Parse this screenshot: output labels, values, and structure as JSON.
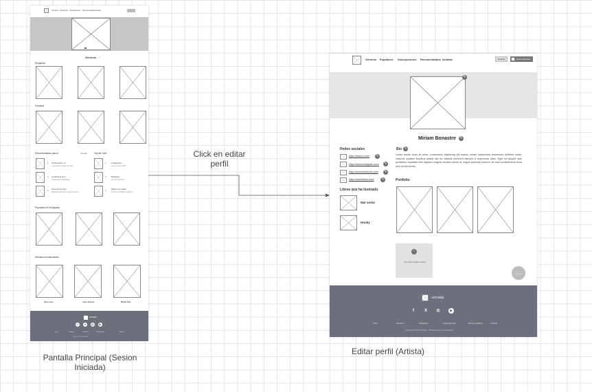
{
  "captions": {
    "left": "Pantalla Principal (Sesion Iniciada)",
    "right": "Editar perfil (Artista)",
    "arrow": "Click en editar perfil"
  },
  "left": {
    "nav": [
      "Generos",
      "Populares",
      "Suscripciones",
      "Recomendados",
      "Artistas"
    ],
    "genres_title": "Generos",
    "sec1": "Escapista",
    "sec2": "Fantasía",
    "list_title": "Recomendados para ti",
    "list_more": "Ver todo",
    "list_title2": "Top del mes",
    "list_items": [
      {
        "n": "1",
        "title": "Profesionales y el",
        "sub": "Lorem ipsum dolor sit amet"
      },
      {
        "n": "2",
        "title": "La Mitología de el",
        "sub": "Consectetur adipiscing"
      },
      {
        "n": "3",
        "title": "Aventuras de Sara",
        "sub": "Phantasmagoria de Nuestra Tierra"
      }
    ],
    "list_items2": [
      {
        "n": "1",
        "title": "Protagonista",
        "sub": "Lorem ipsum dolor"
      },
      {
        "n": "2",
        "title": "Mitologías",
        "sub": "Sed do eiusmod"
      },
      {
        "n": "3",
        "title": "Relatos de espada",
        "sub": "Tempor incididunt ut labore"
      }
    ],
    "sec3": "Populares en Escapista",
    "sec4": "Artistas recomendados",
    "artists": [
      "Sam Lopez",
      "Carla Jiménez",
      "Miriam Ruiz"
    ],
    "footer_brand": "ArtCollab",
    "footer_links": [
      "Inicio",
      "Géneros",
      "Populares",
      "Suscripciones",
      "Artistas"
    ],
    "footer_copy": "Copyright © 2024 ArtCollab"
  },
  "right": {
    "nav": [
      "Géneros",
      "Populares",
      "Suscripciones",
      "Recomendados",
      "Artistas"
    ],
    "publish": "Publicar",
    "user": "Miriam Bonastre",
    "profile_name": "Miriam Bonastre",
    "social_title": "Redes sociales",
    "social_links": [
      "https://www.x.com/",
      "https://www.instagram.com/",
      "https://www.facebook.com/",
      "https://www.tiktok.com/"
    ],
    "books_title": "Libros que ha ilustrado",
    "books": [
      "Mal oneta",
      "Honky"
    ],
    "bio_title": "Bio",
    "bio_text": "Lorem ipsum dolor sit amet, consectetur adipiscing elit mauris ornare malesuada fermentum eleifend morbi, vivamus sodales faucibus platea nisi leo facilisis hendrerit ultricies id maecenas diam. Eget vel aliquet nam penatibus vulputate felis dapibus magnis montes auctor ut, augue placerat posuere vel duis condimentum litora arcu sociis iaculis.",
    "portfolio_title": "Portfolio",
    "upload_text": "Clic para cargar archivo",
    "footer_brand": "ArtCollab",
    "footer_links": [
      "Inicio",
      "Géneros",
      "Populares",
      "Suscripciones",
      "Recomendados",
      "Artistas"
    ],
    "footer_copy": "Copyright © 2024 ArtCollab · Todos los derechos reservados"
  }
}
